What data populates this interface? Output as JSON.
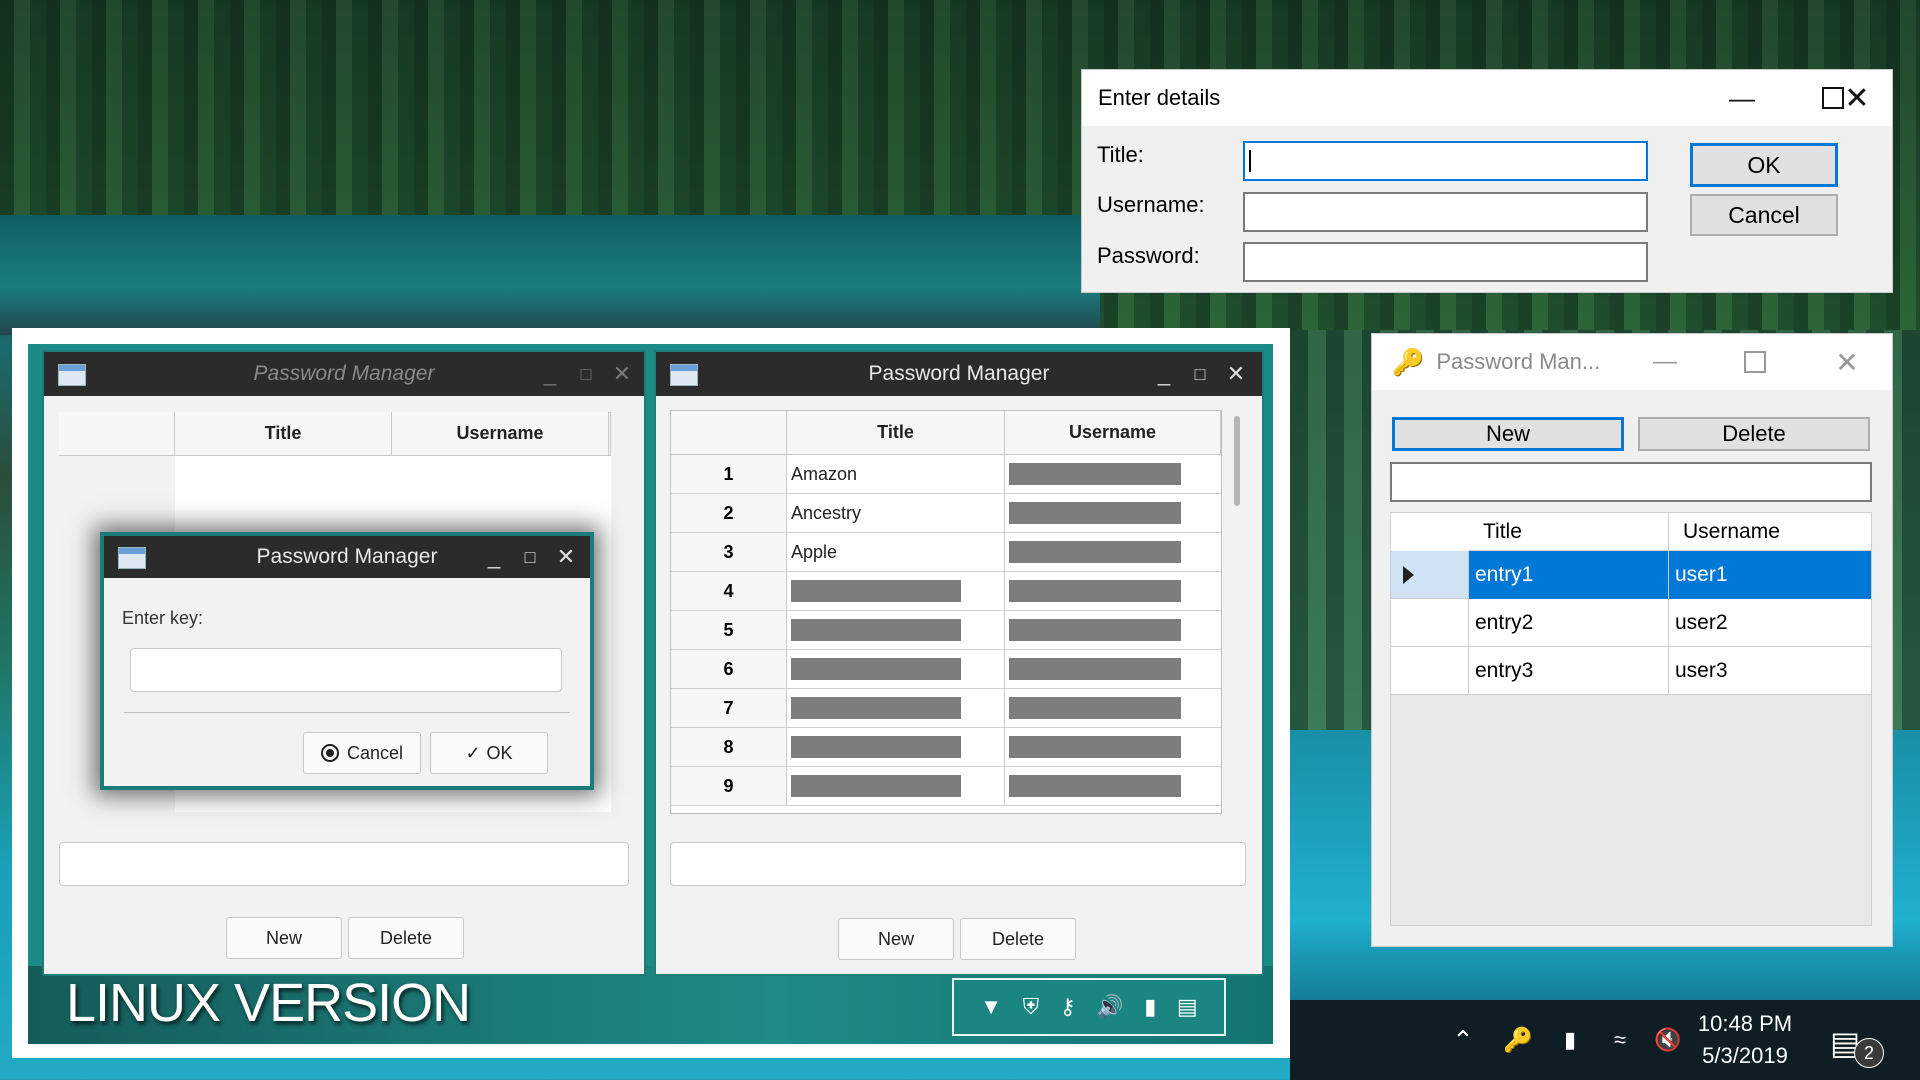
{
  "enter_details": {
    "title": "Enter details",
    "title_label": "Title:",
    "username_label": "Username:",
    "password_label": "Password:",
    "title_value": "",
    "username_value": "",
    "password_value": "",
    "ok_label": "OK",
    "cancel_label": "Cancel"
  },
  "win_app": {
    "title": "Password Man...",
    "new_label": "New",
    "delete_label": "Delete",
    "search_value": "",
    "columns": [
      "Title",
      "Username"
    ],
    "rows": [
      {
        "title": "entry1",
        "username": "user1"
      },
      {
        "title": "entry2",
        "username": "user2"
      },
      {
        "title": "entry3",
        "username": "user3"
      }
    ]
  },
  "linux_left": {
    "title": "Password Manager",
    "columns": [
      "Title",
      "Username"
    ],
    "new_label": "New",
    "delete_label": "Delete"
  },
  "key_dialog": {
    "title": "Password Manager",
    "prompt": "Enter key:",
    "key_value": "",
    "cancel_label": "Cancel",
    "ok_label": "OK"
  },
  "linux_right": {
    "title": "Password Manager",
    "columns": [
      "Title",
      "Username"
    ],
    "rows": [
      {
        "n": "1",
        "title": "Amazon"
      },
      {
        "n": "2",
        "title": "Ancestry"
      },
      {
        "n": "3",
        "title": "Apple"
      },
      {
        "n": "4",
        "title": ""
      },
      {
        "n": "5",
        "title": ""
      },
      {
        "n": "6",
        "title": ""
      },
      {
        "n": "7",
        "title": ""
      },
      {
        "n": "8",
        "title": ""
      },
      {
        "n": "9",
        "title": ""
      }
    ],
    "new_label": "New",
    "delete_label": "Delete"
  },
  "caption": "LINUX VERSION",
  "taskbar": {
    "time": "10:48 PM",
    "date": "5/3/2019",
    "notification_count": "2"
  }
}
